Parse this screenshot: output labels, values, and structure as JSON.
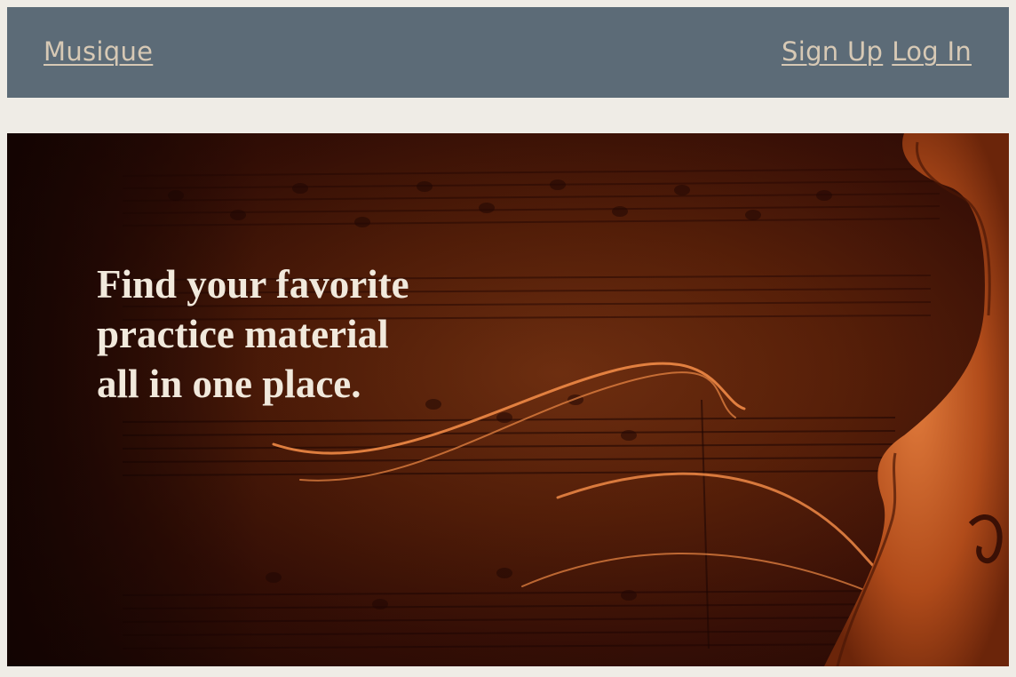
{
  "navbar": {
    "brand": "Musique",
    "links": [
      {
        "label": "Sign Up"
      },
      {
        "label": "Log In"
      }
    ]
  },
  "hero": {
    "heading_lines": [
      "Find your favorite",
      "practice material",
      "all in one place."
    ],
    "image": "violin-sheet-music-background"
  },
  "colors": {
    "page_background": "#efece6",
    "navbar_background": "#5c6b77",
    "link_color": "#d7c9b5",
    "heading_color": "#f1e9dc",
    "hero_dark": "#3a1006",
    "hero_accent": "#e0763a"
  }
}
